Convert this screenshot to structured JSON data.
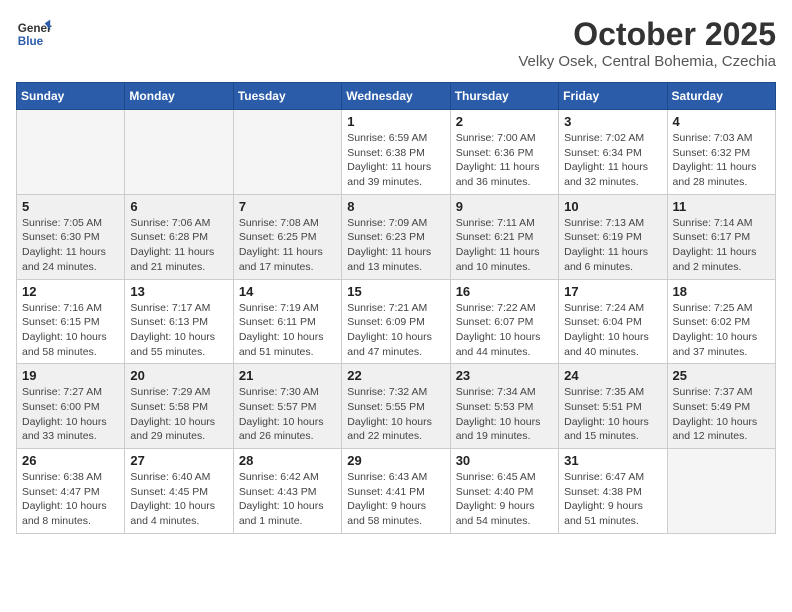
{
  "header": {
    "logo_line1": "General",
    "logo_line2": "Blue",
    "month_title": "October 2025",
    "location": "Velky Osek, Central Bohemia, Czechia"
  },
  "days_of_week": [
    "Sunday",
    "Monday",
    "Tuesday",
    "Wednesday",
    "Thursday",
    "Friday",
    "Saturday"
  ],
  "weeks": [
    [
      {
        "day": "",
        "info": ""
      },
      {
        "day": "",
        "info": ""
      },
      {
        "day": "",
        "info": ""
      },
      {
        "day": "1",
        "info": "Sunrise: 6:59 AM\nSunset: 6:38 PM\nDaylight: 11 hours and 39 minutes."
      },
      {
        "day": "2",
        "info": "Sunrise: 7:00 AM\nSunset: 6:36 PM\nDaylight: 11 hours and 36 minutes."
      },
      {
        "day": "3",
        "info": "Sunrise: 7:02 AM\nSunset: 6:34 PM\nDaylight: 11 hours and 32 minutes."
      },
      {
        "day": "4",
        "info": "Sunrise: 7:03 AM\nSunset: 6:32 PM\nDaylight: 11 hours and 28 minutes."
      }
    ],
    [
      {
        "day": "5",
        "info": "Sunrise: 7:05 AM\nSunset: 6:30 PM\nDaylight: 11 hours and 24 minutes."
      },
      {
        "day": "6",
        "info": "Sunrise: 7:06 AM\nSunset: 6:28 PM\nDaylight: 11 hours and 21 minutes."
      },
      {
        "day": "7",
        "info": "Sunrise: 7:08 AM\nSunset: 6:25 PM\nDaylight: 11 hours and 17 minutes."
      },
      {
        "day": "8",
        "info": "Sunrise: 7:09 AM\nSunset: 6:23 PM\nDaylight: 11 hours and 13 minutes."
      },
      {
        "day": "9",
        "info": "Sunrise: 7:11 AM\nSunset: 6:21 PM\nDaylight: 11 hours and 10 minutes."
      },
      {
        "day": "10",
        "info": "Sunrise: 7:13 AM\nSunset: 6:19 PM\nDaylight: 11 hours and 6 minutes."
      },
      {
        "day": "11",
        "info": "Sunrise: 7:14 AM\nSunset: 6:17 PM\nDaylight: 11 hours and 2 minutes."
      }
    ],
    [
      {
        "day": "12",
        "info": "Sunrise: 7:16 AM\nSunset: 6:15 PM\nDaylight: 10 hours and 58 minutes."
      },
      {
        "day": "13",
        "info": "Sunrise: 7:17 AM\nSunset: 6:13 PM\nDaylight: 10 hours and 55 minutes."
      },
      {
        "day": "14",
        "info": "Sunrise: 7:19 AM\nSunset: 6:11 PM\nDaylight: 10 hours and 51 minutes."
      },
      {
        "day": "15",
        "info": "Sunrise: 7:21 AM\nSunset: 6:09 PM\nDaylight: 10 hours and 47 minutes."
      },
      {
        "day": "16",
        "info": "Sunrise: 7:22 AM\nSunset: 6:07 PM\nDaylight: 10 hours and 44 minutes."
      },
      {
        "day": "17",
        "info": "Sunrise: 7:24 AM\nSunset: 6:04 PM\nDaylight: 10 hours and 40 minutes."
      },
      {
        "day": "18",
        "info": "Sunrise: 7:25 AM\nSunset: 6:02 PM\nDaylight: 10 hours and 37 minutes."
      }
    ],
    [
      {
        "day": "19",
        "info": "Sunrise: 7:27 AM\nSunset: 6:00 PM\nDaylight: 10 hours and 33 minutes."
      },
      {
        "day": "20",
        "info": "Sunrise: 7:29 AM\nSunset: 5:58 PM\nDaylight: 10 hours and 29 minutes."
      },
      {
        "day": "21",
        "info": "Sunrise: 7:30 AM\nSunset: 5:57 PM\nDaylight: 10 hours and 26 minutes."
      },
      {
        "day": "22",
        "info": "Sunrise: 7:32 AM\nSunset: 5:55 PM\nDaylight: 10 hours and 22 minutes."
      },
      {
        "day": "23",
        "info": "Sunrise: 7:34 AM\nSunset: 5:53 PM\nDaylight: 10 hours and 19 minutes."
      },
      {
        "day": "24",
        "info": "Sunrise: 7:35 AM\nSunset: 5:51 PM\nDaylight: 10 hours and 15 minutes."
      },
      {
        "day": "25",
        "info": "Sunrise: 7:37 AM\nSunset: 5:49 PM\nDaylight: 10 hours and 12 minutes."
      }
    ],
    [
      {
        "day": "26",
        "info": "Sunrise: 6:38 AM\nSunset: 4:47 PM\nDaylight: 10 hours and 8 minutes."
      },
      {
        "day": "27",
        "info": "Sunrise: 6:40 AM\nSunset: 4:45 PM\nDaylight: 10 hours and 4 minutes."
      },
      {
        "day": "28",
        "info": "Sunrise: 6:42 AM\nSunset: 4:43 PM\nDaylight: 10 hours and 1 minute."
      },
      {
        "day": "29",
        "info": "Sunrise: 6:43 AM\nSunset: 4:41 PM\nDaylight: 9 hours and 58 minutes."
      },
      {
        "day": "30",
        "info": "Sunrise: 6:45 AM\nSunset: 4:40 PM\nDaylight: 9 hours and 54 minutes."
      },
      {
        "day": "31",
        "info": "Sunrise: 6:47 AM\nSunset: 4:38 PM\nDaylight: 9 hours and 51 minutes."
      },
      {
        "day": "",
        "info": ""
      }
    ]
  ]
}
